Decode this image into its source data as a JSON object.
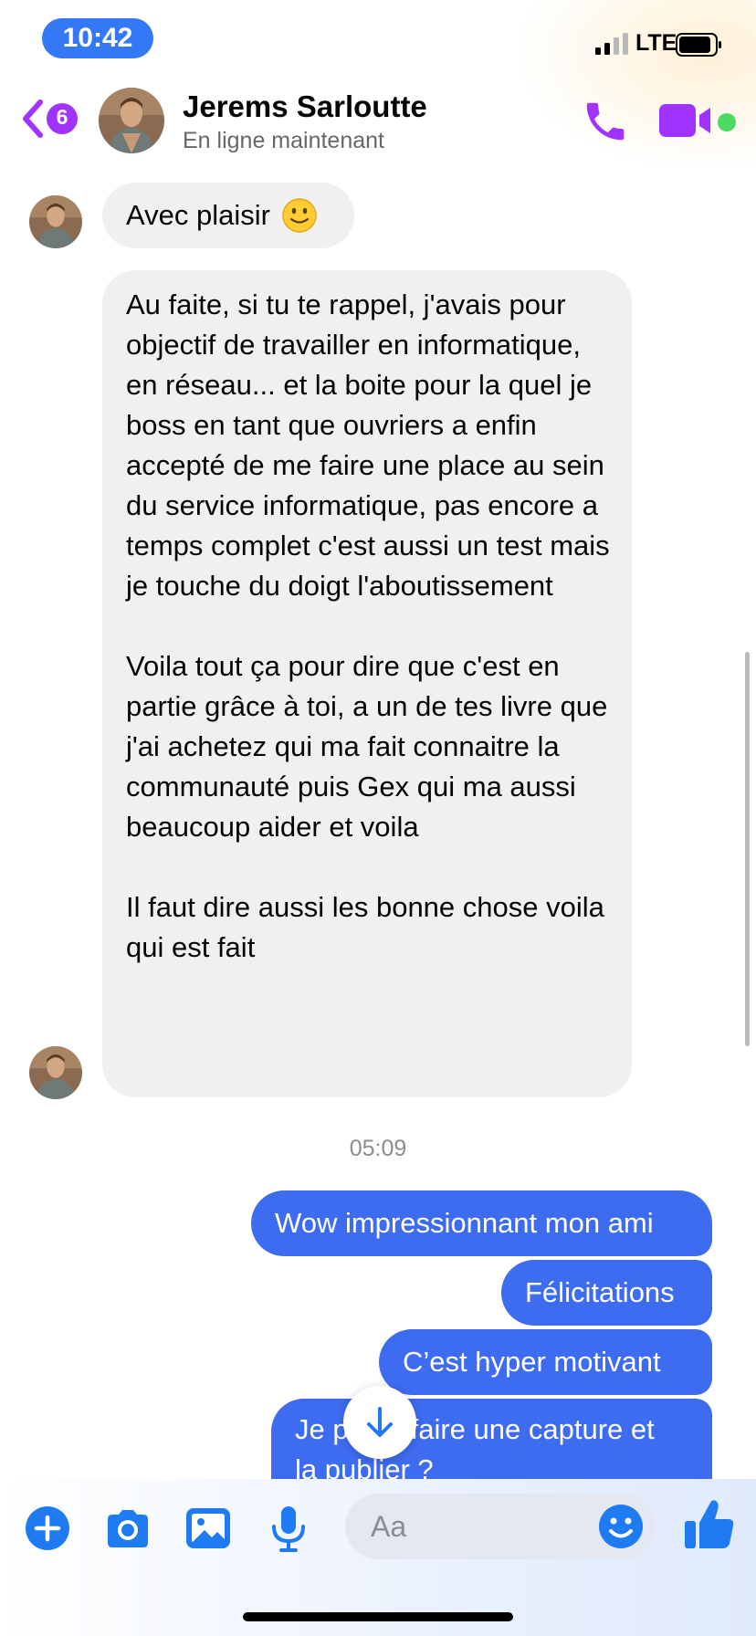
{
  "status_bar": {
    "time": "10:42",
    "network": "LTE"
  },
  "header": {
    "unread_count": "6",
    "contact_name": "Jerems Sarloutte",
    "contact_status": "En ligne maintenant"
  },
  "messages": {
    "incoming": [
      {
        "text": "Avec plaisir"
      },
      {
        "p1": "Au faite, si tu te rappel, j'avais pour objectif de travailler en informatique, en réseau... et la boite pour la quel je boss en tant que ouvriers a enfin accepté de me faire une place au sein du service informatique, pas encore a temps complet c'est aussi un test mais je touche du doigt l'aboutissement",
        "p2": "Voila tout ça pour dire que c'est en partie grâce à toi, a un de tes livre que j'ai achetez qui ma fait connaitre la communauté puis Gex qui ma aussi beaucoup aider et voila",
        "p3": "Il faut dire aussi les bonne chose voila qui est fait"
      }
    ],
    "timestamp": "05:09",
    "outgoing": [
      {
        "text": "Wow impressionnant mon ami"
      },
      {
        "text": "Félicitations"
      },
      {
        "text": "C’est hyper motivant"
      },
      {
        "line1": "Je p",
        "line1b": "faire une capture et",
        "line2": "la publier ?"
      }
    ]
  },
  "composer": {
    "placeholder": "Aa"
  },
  "icons": {
    "back": "chevron-left-icon",
    "call": "phone-icon",
    "video": "video-camera-icon",
    "plus": "plus-icon",
    "camera": "camera-icon",
    "gallery": "image-icon",
    "mic": "microphone-icon",
    "emoji": "smiley-icon",
    "like": "thumbs-up-icon",
    "scroll_down": "arrow-down-icon"
  },
  "colors": {
    "accent_purple": "#a033ff",
    "outgoing_bubble": "#3e6cf1",
    "incoming_bubble": "#f0f0f0",
    "composer_icons": "#1f7bf2",
    "online": "#4cd964"
  }
}
